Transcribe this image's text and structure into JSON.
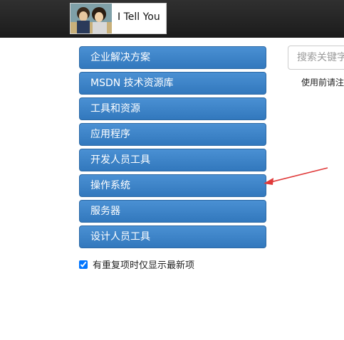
{
  "header": {
    "logo_text": "I Tell You"
  },
  "menu": {
    "items": [
      {
        "label": "企业解决方案"
      },
      {
        "label": "MSDN 技术资源库"
      },
      {
        "label": "工具和资源"
      },
      {
        "label": "应用程序"
      },
      {
        "label": "开发人员工具"
      },
      {
        "label": "操作系统"
      },
      {
        "label": "服务器"
      },
      {
        "label": "设计人员工具"
      }
    ]
  },
  "search": {
    "placeholder": "搜索关键字"
  },
  "notice": {
    "text": "使用前请注"
  },
  "options": {
    "dedupe_label": "有重复项时仅显示最新项",
    "dedupe_checked": true
  },
  "colors": {
    "menu_bg": "#3a82c9",
    "topbar_bg": "#222222",
    "annotation_arrow": "#e03a3a"
  },
  "icons": {
    "annotation": "arrow-icon"
  }
}
